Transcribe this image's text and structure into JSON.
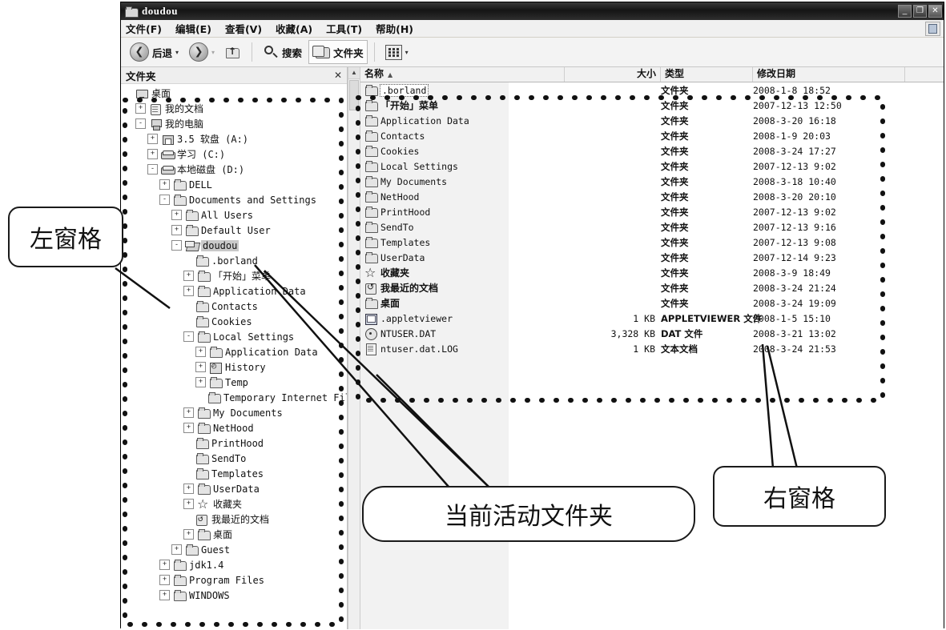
{
  "window": {
    "title": "doudou",
    "icon": "folder-open-icon",
    "controls": [
      {
        "name": "minimize-button",
        "glyph": "_"
      },
      {
        "name": "restore-button",
        "glyph": "❐"
      },
      {
        "name": "close-button",
        "glyph": "✕"
      }
    ]
  },
  "menubar": {
    "items": [
      {
        "label": "文件(F)"
      },
      {
        "label": "编辑(E)"
      },
      {
        "label": "查看(V)"
      },
      {
        "label": "收藏(A)"
      },
      {
        "label": "工具(T)"
      },
      {
        "label": "帮助(H)"
      }
    ]
  },
  "toolbar": {
    "back_label": "后退",
    "forward_label": "",
    "up_label": "",
    "search_label": "搜索",
    "folders_label": "文件夹",
    "views_label": "",
    "caret": "▾"
  },
  "folders_pane": {
    "header": "文件夹",
    "close_glyph": "✕",
    "tree": [
      {
        "label": "桌面",
        "indent": 0,
        "expander": "",
        "icon": "desktop-icon"
      },
      {
        "label": "我的文档",
        "indent": 1,
        "expander": "+",
        "icon": "my-documents-icon"
      },
      {
        "label": "我的电脑",
        "indent": 1,
        "expander": "-",
        "icon": "my-computer-icon"
      },
      {
        "label": "3.5 软盘 (A:)",
        "indent": 2,
        "expander": "+",
        "icon": "floppy-drive-icon"
      },
      {
        "label": "学习 (C:)",
        "indent": 2,
        "expander": "+",
        "icon": "hard-disk-icon"
      },
      {
        "label": "本地磁盘 (D:)",
        "indent": 2,
        "expander": "-",
        "icon": "hard-disk-icon"
      },
      {
        "label": "DELL",
        "indent": 3,
        "expander": "+",
        "icon": "folder-icon"
      },
      {
        "label": "Documents and Settings",
        "indent": 3,
        "expander": "-",
        "icon": "folder-icon"
      },
      {
        "label": "All Users",
        "indent": 4,
        "expander": "+",
        "icon": "folder-icon"
      },
      {
        "label": "Default User",
        "indent": 4,
        "expander": "+",
        "icon": "folder-icon"
      },
      {
        "label": "doudou",
        "indent": 4,
        "expander": "-",
        "icon": "folder-open-icon",
        "selected": true
      },
      {
        "label": ".borland",
        "indent": 5,
        "expander": "",
        "icon": "folder-icon"
      },
      {
        "label": "「开始」菜单",
        "indent": 5,
        "expander": "+",
        "icon": "folder-icon"
      },
      {
        "label": "Application Data",
        "indent": 5,
        "expander": "+",
        "icon": "folder-icon"
      },
      {
        "label": "Contacts",
        "indent": 5,
        "expander": "",
        "icon": "folder-icon"
      },
      {
        "label": "Cookies",
        "indent": 5,
        "expander": "",
        "icon": "folder-icon"
      },
      {
        "label": "Local Settings",
        "indent": 5,
        "expander": "-",
        "icon": "folder-icon"
      },
      {
        "label": "Application Data",
        "indent": 6,
        "expander": "+",
        "icon": "folder-icon"
      },
      {
        "label": "History",
        "indent": 6,
        "expander": "+",
        "icon": "history-icon"
      },
      {
        "label": "Temp",
        "indent": 6,
        "expander": "+",
        "icon": "folder-icon"
      },
      {
        "label": "Temporary Internet Files",
        "indent": 6,
        "expander": "",
        "icon": "folder-icon"
      },
      {
        "label": "My Documents",
        "indent": 5,
        "expander": "+",
        "icon": "folder-icon"
      },
      {
        "label": "NetHood",
        "indent": 5,
        "expander": "+",
        "icon": "folder-icon"
      },
      {
        "label": "PrintHood",
        "indent": 5,
        "expander": "",
        "icon": "folder-icon"
      },
      {
        "label": "SendTo",
        "indent": 5,
        "expander": "",
        "icon": "folder-icon"
      },
      {
        "label": "Templates",
        "indent": 5,
        "expander": "",
        "icon": "folder-icon"
      },
      {
        "label": "UserData",
        "indent": 5,
        "expander": "+",
        "icon": "folder-icon"
      },
      {
        "label": "收藏夹",
        "indent": 5,
        "expander": "+",
        "icon": "favorites-star-icon"
      },
      {
        "label": "我最近的文档",
        "indent": 5,
        "expander": "",
        "icon": "recent-documents-icon"
      },
      {
        "label": "桌面",
        "indent": 5,
        "expander": "+",
        "icon": "folder-icon"
      },
      {
        "label": "Guest",
        "indent": 4,
        "expander": "+",
        "icon": "folder-icon"
      },
      {
        "label": "jdk1.4",
        "indent": 3,
        "expander": "+",
        "icon": "folder-icon"
      },
      {
        "label": "Program Files",
        "indent": 3,
        "expander": "+",
        "icon": "folder-icon"
      },
      {
        "label": "WINDOWS",
        "indent": 3,
        "expander": "+",
        "icon": "folder-icon"
      }
    ]
  },
  "files_pane": {
    "columns": [
      {
        "key": "name",
        "label": "名称",
        "sort": "▲"
      },
      {
        "key": "size",
        "label": "大小",
        "sort": ""
      },
      {
        "key": "type",
        "label": "类型",
        "sort": ""
      },
      {
        "key": "date",
        "label": "修改日期",
        "sort": ""
      }
    ],
    "rows": [
      {
        "name": ".borland",
        "size": "",
        "type": "文件夹",
        "date": "2008-1-8 18:52",
        "icon": "folder-icon",
        "selected": true,
        "cn": false
      },
      {
        "name": "「开始」菜单",
        "size": "",
        "type": "文件夹",
        "date": "2007-12-13 12:50",
        "icon": "folder-icon",
        "cn": true
      },
      {
        "name": "Application Data",
        "size": "",
        "type": "文件夹",
        "date": "2008-3-20 16:18",
        "icon": "folder-icon",
        "cn": false
      },
      {
        "name": "Contacts",
        "size": "",
        "type": "文件夹",
        "date": "2008-1-9 20:03",
        "icon": "folder-icon",
        "cn": false
      },
      {
        "name": "Cookies",
        "size": "",
        "type": "文件夹",
        "date": "2008-3-24 17:27",
        "icon": "folder-icon",
        "cn": false
      },
      {
        "name": "Local Settings",
        "size": "",
        "type": "文件夹",
        "date": "2007-12-13 9:02",
        "icon": "folder-icon",
        "cn": false
      },
      {
        "name": "My Documents",
        "size": "",
        "type": "文件夹",
        "date": "2008-3-18 10:40",
        "icon": "folder-icon",
        "cn": false
      },
      {
        "name": "NetHood",
        "size": "",
        "type": "文件夹",
        "date": "2008-3-20 20:10",
        "icon": "folder-icon",
        "cn": false
      },
      {
        "name": "PrintHood",
        "size": "",
        "type": "文件夹",
        "date": "2007-12-13 9:02",
        "icon": "folder-icon",
        "cn": false
      },
      {
        "name": "SendTo",
        "size": "",
        "type": "文件夹",
        "date": "2007-12-13 9:16",
        "icon": "folder-icon",
        "cn": false
      },
      {
        "name": "Templates",
        "size": "",
        "type": "文件夹",
        "date": "2007-12-13 9:08",
        "icon": "folder-icon",
        "cn": false
      },
      {
        "name": "UserData",
        "size": "",
        "type": "文件夹",
        "date": "2007-12-14 9:23",
        "icon": "folder-icon",
        "cn": false
      },
      {
        "name": "收藏夹",
        "size": "",
        "type": "文件夹",
        "date": "2008-3-9 18:49",
        "icon": "favorites-star-icon",
        "cn": true
      },
      {
        "name": "我最近的文档",
        "size": "",
        "type": "文件夹",
        "date": "2008-3-24 21:24",
        "icon": "recent-documents-icon",
        "cn": true
      },
      {
        "name": "桌面",
        "size": "",
        "type": "文件夹",
        "date": "2008-3-24 19:09",
        "icon": "folder-icon",
        "cn": true
      },
      {
        "name": ".appletviewer",
        "size": "1 KB",
        "type": "APPLETVIEWER 文件",
        "date": "2008-1-5 15:10",
        "icon": "applet-file-icon",
        "cn": false
      },
      {
        "name": "NTUSER.DAT",
        "size": "3,328 KB",
        "type": "DAT 文件",
        "date": "2008-3-21 13:02",
        "icon": "dat-file-icon",
        "cn": false
      },
      {
        "name": "ntuser.dat.LOG",
        "size": "1 KB",
        "type": "文本文档",
        "date": "2008-3-24 21:53",
        "icon": "text-file-icon",
        "cn": false
      }
    ]
  },
  "annotations": {
    "left_pane": "左窗格",
    "right_pane": "右窗格",
    "active_folder": "当前活动文件夹"
  }
}
